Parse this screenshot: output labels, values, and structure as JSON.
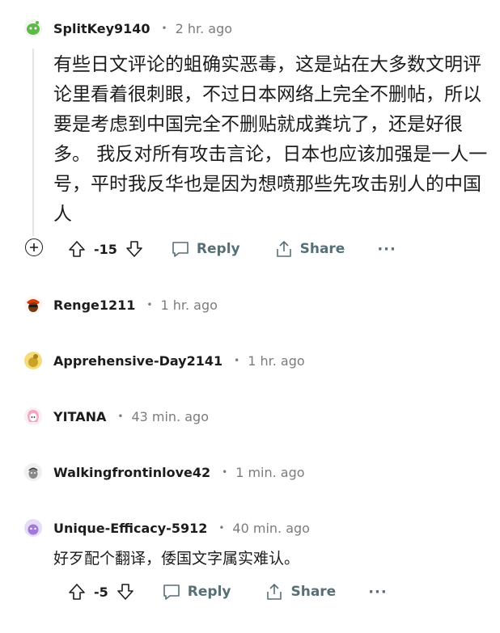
{
  "comments": [
    {
      "username": "SplitKey9140",
      "time": "2 hr. ago",
      "body": "有些日文评论的蛆确实恶毒，这是站在大多数文明评论里看着很刺眼，不过日本网络上完全不删帖，所以要是考虑到中国完全不删贴就成粪坑了，还是好很多。 我反对所有攻击言论，日本也应该加强是一人一号，平时我反华也是因为想喷那些先攻击别人的中国人",
      "score": "-15",
      "reply_label": "Reply",
      "share_label": "Share",
      "more_label": "···"
    },
    {
      "username": "Renge1211",
      "time": "1 hr. ago"
    },
    {
      "username": "Apprehensive-Day2141",
      "time": "1 hr. ago"
    },
    {
      "username": "YITANA",
      "time": "43 min. ago"
    },
    {
      "username": "Walkingfrontinlove42",
      "time": "1 min. ago"
    },
    {
      "username": "Unique-Efficacy-5912",
      "time": "40 min. ago",
      "body": "好歹配个翻译，倭国文字属实难认。",
      "score": "-5",
      "reply_label": "Reply",
      "share_label": "Share",
      "more_label": "···"
    }
  ],
  "separator": "•",
  "colors": {
    "text": "#1c1c1c",
    "meta": "#7c7c7c",
    "action": "#576f76",
    "thread": "#e4e4e4"
  },
  "icons": [
    "green-alien-avatar-icon",
    "red-hat-avatar-icon",
    "yellow-avatar-icon",
    "pink-hair-avatar-icon",
    "gray-avatar-icon",
    "purple-avatar-icon",
    "expand-thread-icon",
    "upvote-icon",
    "downvote-icon",
    "reply-icon",
    "share-icon"
  ]
}
